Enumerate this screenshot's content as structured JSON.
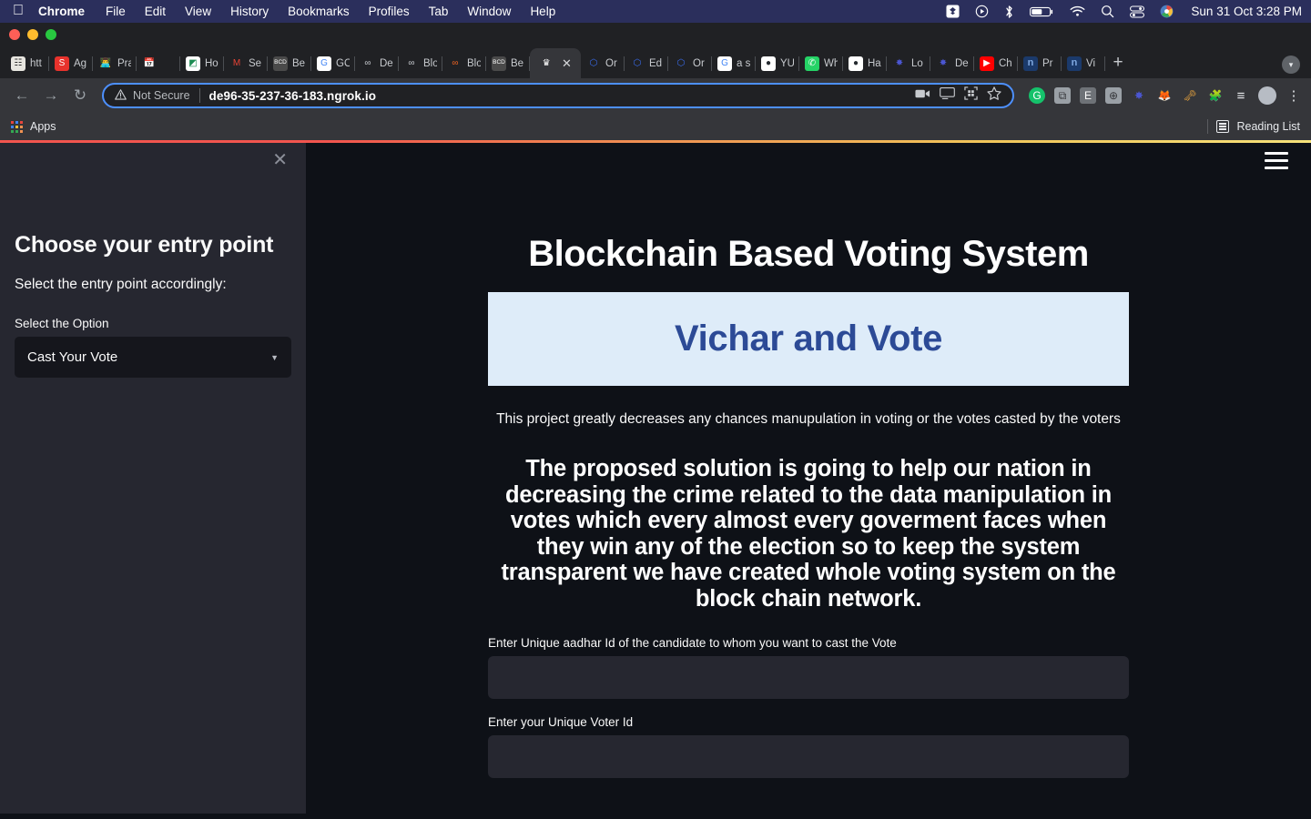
{
  "menubar": {
    "apple": "apple-logo",
    "items": [
      {
        "label": "Chrome",
        "bold": true
      },
      {
        "label": "File",
        "bold": false
      },
      {
        "label": "Edit",
        "bold": false
      },
      {
        "label": "View",
        "bold": false
      },
      {
        "label": "History",
        "bold": false
      },
      {
        "label": "Bookmarks",
        "bold": false
      },
      {
        "label": "Profiles",
        "bold": false
      },
      {
        "label": "Tab",
        "bold": false
      },
      {
        "label": "Window",
        "bold": false
      },
      {
        "label": "Help",
        "bold": false
      }
    ],
    "status_icons": [
      "dropbox-icon",
      "screen-record-icon",
      "bluetooth-icon",
      "battery-icon",
      "wifi-icon",
      "search-icon",
      "control-center-icon",
      "user-avatar-icon"
    ],
    "clock": "Sun 31 Oct  3:28 PM"
  },
  "browser": {
    "window_controls": [
      "close-button",
      "minimize-button",
      "maximize-button"
    ],
    "tabs": [
      {
        "label": "htt",
        "fav": "☷",
        "favbg": "#e8e6e0",
        "favcolor": "#333333",
        "active": false
      },
      {
        "label": "Ag",
        "fav": "S",
        "favbg": "#e8322c",
        "favcolor": "#ffffff",
        "active": false
      },
      {
        "label": "Pra",
        "fav": "👨‍💻",
        "favbg": "transparent",
        "favcolor": "#ffffff",
        "active": false
      },
      {
        "label": "",
        "fav": "📅",
        "favbg": "transparent",
        "favcolor": "#ffffff",
        "active": false
      },
      {
        "label": "Ho",
        "fav": "◩",
        "favbg": "#ffffff",
        "favcolor": "#1c8c52",
        "active": false
      },
      {
        "label": "Se",
        "fav": "M",
        "favbg": "transparent",
        "favcolor": "#e94335",
        "active": false
      },
      {
        "label": "Be",
        "fav": "BCD",
        "favbg": "#4a4a4a",
        "favcolor": "#ffffff",
        "active": false
      },
      {
        "label": "GO",
        "fav": "G",
        "favbg": "#ffffff",
        "favcolor": "#4285f4",
        "active": false
      },
      {
        "label": "De",
        "fav": "∞",
        "favbg": "transparent",
        "favcolor": "#c9ccd1",
        "active": false
      },
      {
        "label": "Blo",
        "fav": "∞",
        "favbg": "transparent",
        "favcolor": "#c9ccd1",
        "active": false
      },
      {
        "label": "Blo",
        "fav": "∞",
        "favbg": "transparent",
        "favcolor": "#f26522",
        "active": false
      },
      {
        "label": "Be",
        "fav": "BCD",
        "favbg": "#4a4a4a",
        "favcolor": "#ffffff",
        "active": false
      },
      {
        "label": "",
        "fav": "♛",
        "favbg": "transparent",
        "favcolor": "#ffffff",
        "active": true
      },
      {
        "label": "Or",
        "fav": "⬡",
        "favbg": "transparent",
        "favcolor": "#3a6df0",
        "active": false
      },
      {
        "label": "Ed",
        "fav": "⬡",
        "favbg": "transparent",
        "favcolor": "#3a6df0",
        "active": false
      },
      {
        "label": "Or",
        "fav": "⬡",
        "favbg": "transparent",
        "favcolor": "#3a6df0",
        "active": false
      },
      {
        "label": "a s",
        "fav": "G",
        "favbg": "#ffffff",
        "favcolor": "#4285f4",
        "active": false
      },
      {
        "label": "YU",
        "fav": "●",
        "favbg": "#ffffff",
        "favcolor": "#24292e",
        "active": false
      },
      {
        "label": "Wh",
        "fav": "✆",
        "favbg": "#25d366",
        "favcolor": "#ffffff",
        "active": false
      },
      {
        "label": "Ha",
        "fav": "●",
        "favbg": "#ffffff",
        "favcolor": "#24292e",
        "active": false
      },
      {
        "label": "Lo",
        "fav": "✸",
        "favbg": "transparent",
        "favcolor": "#4b56d2",
        "active": false
      },
      {
        "label": "De",
        "fav": "✸",
        "favbg": "transparent",
        "favcolor": "#4b56d2",
        "active": false
      },
      {
        "label": "Ch",
        "fav": "▶",
        "favbg": "#ff0000",
        "favcolor": "#ffffff",
        "active": false
      },
      {
        "label": "Pr",
        "fav": "n",
        "favbg": "#1b3a6b",
        "favcolor": "#7fa8e0",
        "active": false
      },
      {
        "label": "Vi",
        "fav": "n",
        "favbg": "#1b3a6b",
        "favcolor": "#7fa8e0",
        "active": false
      }
    ],
    "new_tab": "+",
    "tab_search": "▾",
    "nav": {
      "back": "←",
      "forward": "→",
      "reload": "↻"
    },
    "omnibox": {
      "warning_icon": "⚠",
      "security_label": "Not Secure",
      "url": "de96-35-237-36-183.ngrok.io",
      "actions": [
        "video-camera-icon",
        "cast-icon",
        "qr-code-icon",
        "bookmark-star-icon"
      ]
    },
    "extensions": [
      {
        "name": "grammarly-icon",
        "glyph": "G",
        "bg": "#15c26b",
        "color": "#ffffff"
      },
      {
        "name": "clipboard-icon",
        "glyph": "⧉",
        "bg": "#9aa0a6",
        "color": "#35363a"
      },
      {
        "name": "evernote-icon",
        "glyph": "E",
        "bg": "#6e7277",
        "color": "#ffffff"
      },
      {
        "name": "globe-icon",
        "glyph": "⊕",
        "bg": "#9aa0a6",
        "color": "#35363a"
      },
      {
        "name": "loom-icon",
        "glyph": "✸",
        "bg": "transparent",
        "color": "#4b56d2"
      },
      {
        "name": "metamask-fox-icon",
        "glyph": "🦊",
        "bg": "transparent",
        "color": "#e2761b"
      },
      {
        "name": "key-icon",
        "glyph": "🗝",
        "bg": "transparent",
        "color": "#e8a33d"
      },
      {
        "name": "puzzle-extensions-icon",
        "glyph": "🧩",
        "bg": "transparent",
        "color": "#e8eaed"
      },
      {
        "name": "playlist-icon",
        "glyph": "≡",
        "bg": "transparent",
        "color": "#e8eaed"
      },
      {
        "name": "profile-avatar-icon",
        "glyph": "",
        "bg": "#b7bcc4",
        "color": "#ffffff"
      },
      {
        "name": "chrome-menu-icon",
        "glyph": "⋮",
        "bg": "transparent",
        "color": "#e8eaed"
      }
    ],
    "bookmarks": {
      "apps_label": "Apps",
      "apps_icon": "apps-grid-icon",
      "reading_list_label": "Reading List",
      "reading_list_icon": "reading-list-icon"
    }
  },
  "sidebar": {
    "close_icon": "✕",
    "title": "Choose your entry point",
    "subtitle": "Select the entry point accordingly:",
    "select_label": "Select the Option",
    "select_value": "Cast Your Vote",
    "select_caret": "▼"
  },
  "main": {
    "hamburger_icon": "hamburger-menu-icon",
    "title": "Blockchain Based Voting System",
    "brand": "Vichar and Vote",
    "tagline": "This project greatly decreases any chances manupulation in voting or the votes casted by the voters",
    "pitch": "The proposed solution is going to help our nation in decreasing the crime related to the data manipulation in votes which every almost every goverment faces when they win any of the election so to keep the system transparent we have created whole voting system on the block chain network.",
    "fields": [
      {
        "label": "Enter Unique aadhar Id of the candidate to whom you want to cast the Vote",
        "value": "",
        "placeholder": ""
      },
      {
        "label": "Enter your Unique Voter Id",
        "value": "",
        "placeholder": ""
      }
    ]
  },
  "colors": {
    "menubar_bg": "#2b2f5c",
    "page_bg": "#0e1117",
    "sidebar_bg": "#262730",
    "input_bg": "#262730",
    "banner_bg": "#deecf9",
    "banner_text": "#2c4a96",
    "accent_text": "#fafafa"
  }
}
